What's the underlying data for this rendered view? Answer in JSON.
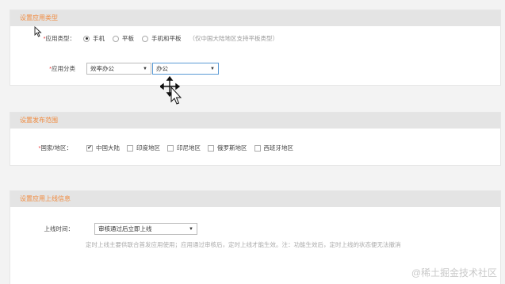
{
  "section1": {
    "title": "设置应用类型",
    "app_type_label": "应用类型：",
    "required_mark": "*",
    "options": [
      "手机",
      "平板",
      "手机和平板"
    ],
    "hint": "（仅中国大陆地区支持平板类型）",
    "category_label": "应用分类",
    "category_primary": "效率办公",
    "category_secondary": "办公"
  },
  "section2": {
    "title": "设置发布范围",
    "region_label": "国家/地区：",
    "required_mark": "*",
    "regions": [
      "中国大陆",
      "印度地区",
      "印尼地区",
      "俄罗斯地区",
      "西班牙地区"
    ],
    "checkmark": "✔"
  },
  "section3": {
    "title": "设置应用上线信息",
    "time_label": "上线时间：",
    "time_value": "审核通过后立即上线",
    "note": "定时上线主要供联合首发应用使用；应用通过审核后，定时上线才能生效。注：功能生效后，定时上线的状态便无法撤消"
  },
  "watermark": "@稀土掘金技术社区",
  "colors": {
    "accent": "#f08a3e",
    "header_bg": "#e4e4e4",
    "focus_border": "#5b9bd5"
  }
}
